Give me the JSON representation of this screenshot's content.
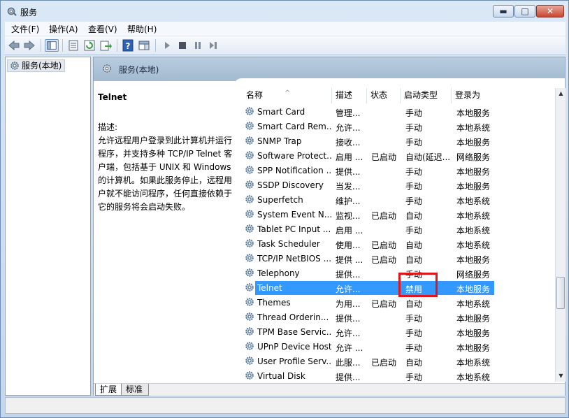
{
  "window": {
    "title": "服务",
    "controls": {
      "minimize": "▬",
      "maximize": "□",
      "close": "✕"
    }
  },
  "menu": [
    "文件(F)",
    "操作(A)",
    "查看(V)",
    "帮助(H)"
  ],
  "toolbar": {
    "icons": [
      "back-arrow-icon",
      "forward-arrow-icon",
      "show-tree-icon",
      "properties-icon",
      "refresh-icon",
      "export-list-icon",
      "help-icon",
      "show-pane-icon",
      "start-service-icon",
      "stop-service-icon",
      "pause-service-icon",
      "restart-service-icon"
    ],
    "play": "▶",
    "stop": "■",
    "pause": "❚❚",
    "restart": "▶❚"
  },
  "tree": {
    "root": "服务(本地)"
  },
  "pane_header": "服务(本地)",
  "description": {
    "service_name": "Telnet",
    "label": "描述:",
    "text": "允许远程用户登录到此计算机并运行程序，并支持多种 TCP/IP Telnet 客户端，包括基于 UNIX 和 Windows 的计算机。如果此服务停止，远程用户就不能访问程序，任何直接依赖于它的服务将会启动失败。"
  },
  "columns": [
    "名称",
    "描述",
    "状态",
    "启动类型",
    "登录为"
  ],
  "rows": [
    {
      "name": "Smart Card",
      "desc": "管理...",
      "status": "",
      "startup": "手动",
      "logon": "本地服务"
    },
    {
      "name": "Smart Card Rem...",
      "desc": "允许...",
      "status": "",
      "startup": "手动",
      "logon": "本地系统"
    },
    {
      "name": "SNMP Trap",
      "desc": "接收...",
      "status": "",
      "startup": "手动",
      "logon": "本地服务"
    },
    {
      "name": "Software Protect...",
      "desc": "启用 ...",
      "status": "已启动",
      "startup": "自动(延迟...",
      "logon": "网络服务"
    },
    {
      "name": "SPP Notification ...",
      "desc": "提供...",
      "status": "",
      "startup": "手动",
      "logon": "本地服务"
    },
    {
      "name": "SSDP Discovery",
      "desc": "当发...",
      "status": "",
      "startup": "手动",
      "logon": "本地服务"
    },
    {
      "name": "Superfetch",
      "desc": "维护...",
      "status": "",
      "startup": "手动",
      "logon": "本地系统"
    },
    {
      "name": "System Event N...",
      "desc": "监视...",
      "status": "已启动",
      "startup": "自动",
      "logon": "本地系统"
    },
    {
      "name": "Tablet PC Input ...",
      "desc": "启用 ...",
      "status": "",
      "startup": "手动",
      "logon": "本地系统"
    },
    {
      "name": "Task Scheduler",
      "desc": "使用...",
      "status": "已启动",
      "startup": "自动",
      "logon": "本地系统"
    },
    {
      "name": "TCP/IP NetBIOS ...",
      "desc": "提供 ...",
      "status": "已启动",
      "startup": "自动",
      "logon": "本地服务"
    },
    {
      "name": "Telephony",
      "desc": "提供...",
      "status": "",
      "startup": "手动",
      "logon": "网络服务"
    },
    {
      "name": "Telnet",
      "desc": "允许...",
      "status": "",
      "startup": "禁用",
      "logon": "本地服务",
      "selected": true
    },
    {
      "name": "Themes",
      "desc": "为用...",
      "status": "已启动",
      "startup": "自动",
      "logon": "本地系统"
    },
    {
      "name": "Thread Orderin...",
      "desc": "提供...",
      "status": "",
      "startup": "手动",
      "logon": "本地服务"
    },
    {
      "name": "TPM Base Servic...",
      "desc": "允许...",
      "status": "",
      "startup": "手动",
      "logon": "本地服务"
    },
    {
      "name": "UPnP Device Host",
      "desc": "允许 ...",
      "status": "",
      "startup": "手动",
      "logon": "本地服务"
    },
    {
      "name": "User Profile Serv...",
      "desc": "此服...",
      "status": "已启动",
      "startup": "自动",
      "logon": "本地系统"
    },
    {
      "name": "Virtual Disk",
      "desc": "提供...",
      "status": "",
      "startup": "手动",
      "logon": "本地系统"
    }
  ],
  "tabs": [
    "扩展",
    "标准"
  ],
  "scrollbar": {
    "up": "▲",
    "down": "▼"
  },
  "colors": {
    "selection": "#3399ff",
    "highlight_box": "#e2141c"
  }
}
